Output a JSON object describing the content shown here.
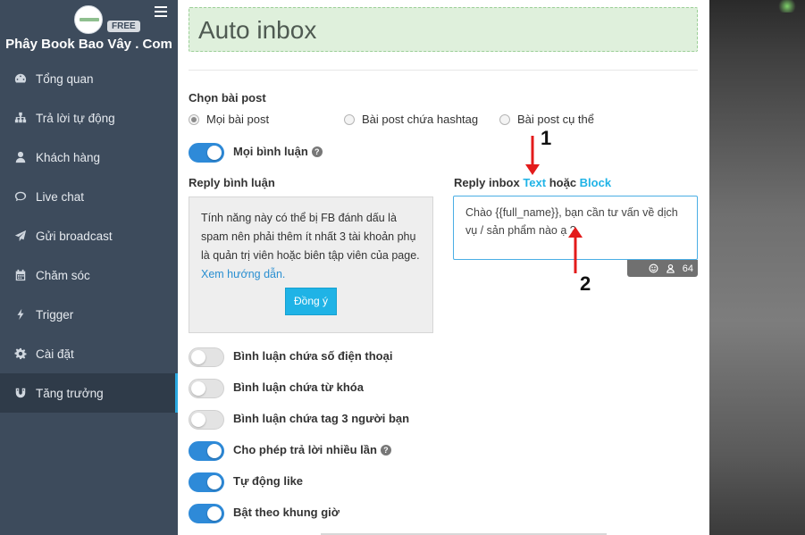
{
  "sidebar": {
    "brand": "Phây Book Bao Vây . Com",
    "badge": "FREE",
    "items": [
      {
        "label": "Tổng quan",
        "icon": "dashboard-icon"
      },
      {
        "label": "Trả lời tự động",
        "icon": "sitemap-icon"
      },
      {
        "label": "Khách hàng",
        "icon": "user-icon"
      },
      {
        "label": "Live chat",
        "icon": "chat-icon"
      },
      {
        "label": "Gửi broadcast",
        "icon": "send-icon"
      },
      {
        "label": "Chăm sóc",
        "icon": "calendar-icon"
      },
      {
        "label": "Trigger",
        "icon": "bolt-icon"
      },
      {
        "label": "Cài đặt",
        "icon": "gear-icon"
      },
      {
        "label": "Tăng trưởng",
        "icon": "magnet-icon",
        "active": true
      }
    ]
  },
  "main": {
    "title": "Auto inbox",
    "post_section": {
      "label": "Chọn bài post",
      "options": [
        "Mọi bài post",
        "Bài post chứa hashtag",
        "Bài post cụ thể"
      ],
      "selected": "Mọi bài post"
    },
    "all_comments": {
      "label": "Mọi bình luận",
      "on": true
    },
    "reply_comment": {
      "label": "Reply bình luận",
      "info": "Tính năng này có thể bị FB đánh dấu là spam nên phải thêm ít nhất 3 tài khoản phụ là quản trị viên hoặc biên tập viên của page.",
      "link": "Xem hướng dẫn.",
      "button": "Đồng ý"
    },
    "reply_inbox": {
      "label_prefix": "Reply inbox",
      "label_text": "Text",
      "label_or": "hoặc",
      "label_block": "Block",
      "message": "Chào {{full_name}}, bạn cần tư vấn về dịch vụ / sản phẩm nào ạ ?",
      "char_count": "64"
    },
    "toggles": [
      {
        "label": "Bình luận chứa số điện thoại",
        "on": false,
        "help": false
      },
      {
        "label": "Bình luận chứa từ khóa",
        "on": false,
        "help": false
      },
      {
        "label": "Bình luận chứa tag 3 người bạn",
        "on": false,
        "help": false
      },
      {
        "label": "Cho phép trả lời nhiều lần",
        "on": true,
        "help": true
      },
      {
        "label": "Tự động like",
        "on": true,
        "help": false
      },
      {
        "label": "Bật theo khung giờ",
        "on": true,
        "help": false
      }
    ]
  },
  "annotations": {
    "one": "1",
    "two": "2"
  },
  "colors": {
    "sidebar": "#3d4b5c",
    "accent": "#1fb3e6",
    "toggle_on": "#2e8ad8",
    "title_bg": "#dff0dc"
  }
}
